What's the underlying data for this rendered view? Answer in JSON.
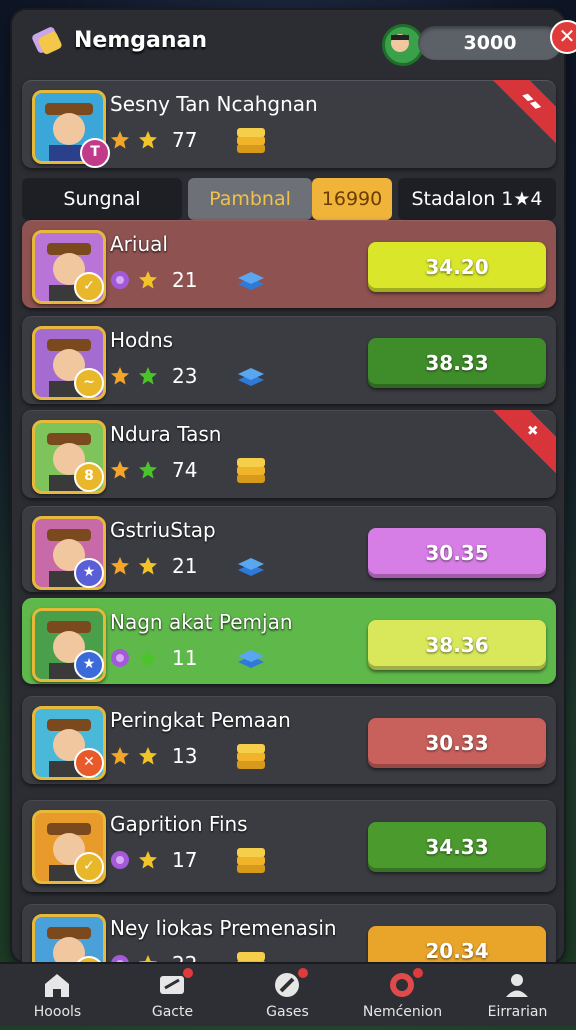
{
  "header": {
    "title": "Nemganan",
    "coins": "3000",
    "close_symbol": "✕"
  },
  "profile": {
    "name": "Sesny Tan Ncahgnan",
    "score": "77",
    "ribbon": "▰▰"
  },
  "tabs": [
    {
      "label": "Sungnal",
      "bg": "#1e1f24",
      "color": "#ffffff"
    },
    {
      "label": "Pambnal",
      "bg": "#6e7077",
      "color": "#f0c24a"
    },
    {
      "label": "16990",
      "bg": "#f0b43a",
      "color": "#6a3d00"
    },
    {
      "label": "Stadalon 1★4",
      "bg": "#1e1f24",
      "color": "#ffffff"
    }
  ],
  "players": [
    {
      "name": "Ariual",
      "stat": "21",
      "score": "34.20",
      "row_bg": "#8e5250",
      "btn_color": "#d9e62a",
      "portrait_bg": "#b874d6",
      "badge_bg": "#e9b82a",
      "badge": "✓",
      "gem": "purple",
      "stack": "blue",
      "corner": ""
    },
    {
      "name": "Hodns",
      "stat": "23",
      "score": "38.33",
      "row_bg": "#3a3c42",
      "btn_color": "#3f8c2a",
      "portrait_bg": "#a46cd0",
      "badge_bg": "#e9b82a",
      "badge": "~",
      "gem": "gold",
      "stack": "blue",
      "corner": ""
    },
    {
      "name": "Ndura Tasn",
      "stat": "74",
      "score": "",
      "row_bg": "#3a3c42",
      "btn_color": "",
      "portrait_bg": "#7ec45a",
      "badge_bg": "#e9b82a",
      "badge": "8",
      "gem": "gold",
      "stack": "gold",
      "corner": "✚"
    },
    {
      "name": "GstriuStap",
      "stat": "21",
      "score": "30.35",
      "row_bg": "#3a3c42",
      "btn_color": "#d77de6",
      "portrait_bg": "#c86aa8",
      "badge_bg": "#5a5fd8",
      "badge": "★",
      "gem": "gold",
      "stack": "blue",
      "corner": ""
    },
    {
      "name": "Nagn akat Pemjan",
      "stat": "11",
      "score": "38.36",
      "row_bg": "#5fb84a",
      "btn_color": "#d9e85a",
      "portrait_bg": "#4aa04a",
      "badge_bg": "#3b6bd8",
      "badge": "★",
      "gem": "purple",
      "stack": "blue",
      "corner": ""
    },
    {
      "name": "Peringkat Pemaan",
      "stat": "13",
      "score": "30.33",
      "row_bg": "#3a3c42",
      "btn_color": "#c8605c",
      "portrait_bg": "#4ab8d8",
      "badge_bg": "#e85a2a",
      "badge": "✕",
      "gem": "gold",
      "stack": "gold",
      "corner": ""
    },
    {
      "name": "Gaprition Fins",
      "stat": "17",
      "score": "34.33",
      "row_bg": "#3a3c42",
      "btn_color": "#4a9a2e",
      "portrait_bg": "#e89a2a",
      "badge_bg": "#e9b82a",
      "badge": "✓",
      "gem": "purple",
      "stack": "gold",
      "corner": ""
    },
    {
      "name": "Ney Iiokas Premenasin",
      "stat": "22",
      "score": "20.34",
      "row_bg": "#3a3c42",
      "btn_color": "#e9a52a",
      "portrait_bg": "#4aa0d8",
      "badge_bg": "#e9b82a",
      "badge": "",
      "gem": "purple",
      "stack": "gold",
      "corner": ""
    }
  ],
  "nav": [
    {
      "label": "Hoools",
      "icon": "home-icon",
      "dot": false
    },
    {
      "label": "Gacte",
      "icon": "mail-icon",
      "dot": true
    },
    {
      "label": "Gases",
      "icon": "pencil-icon",
      "dot": true
    },
    {
      "label": "Nemćenion",
      "icon": "notification-icon",
      "dot": true
    },
    {
      "label": "Eirrarian",
      "icon": "profile-icon",
      "dot": false
    }
  ]
}
